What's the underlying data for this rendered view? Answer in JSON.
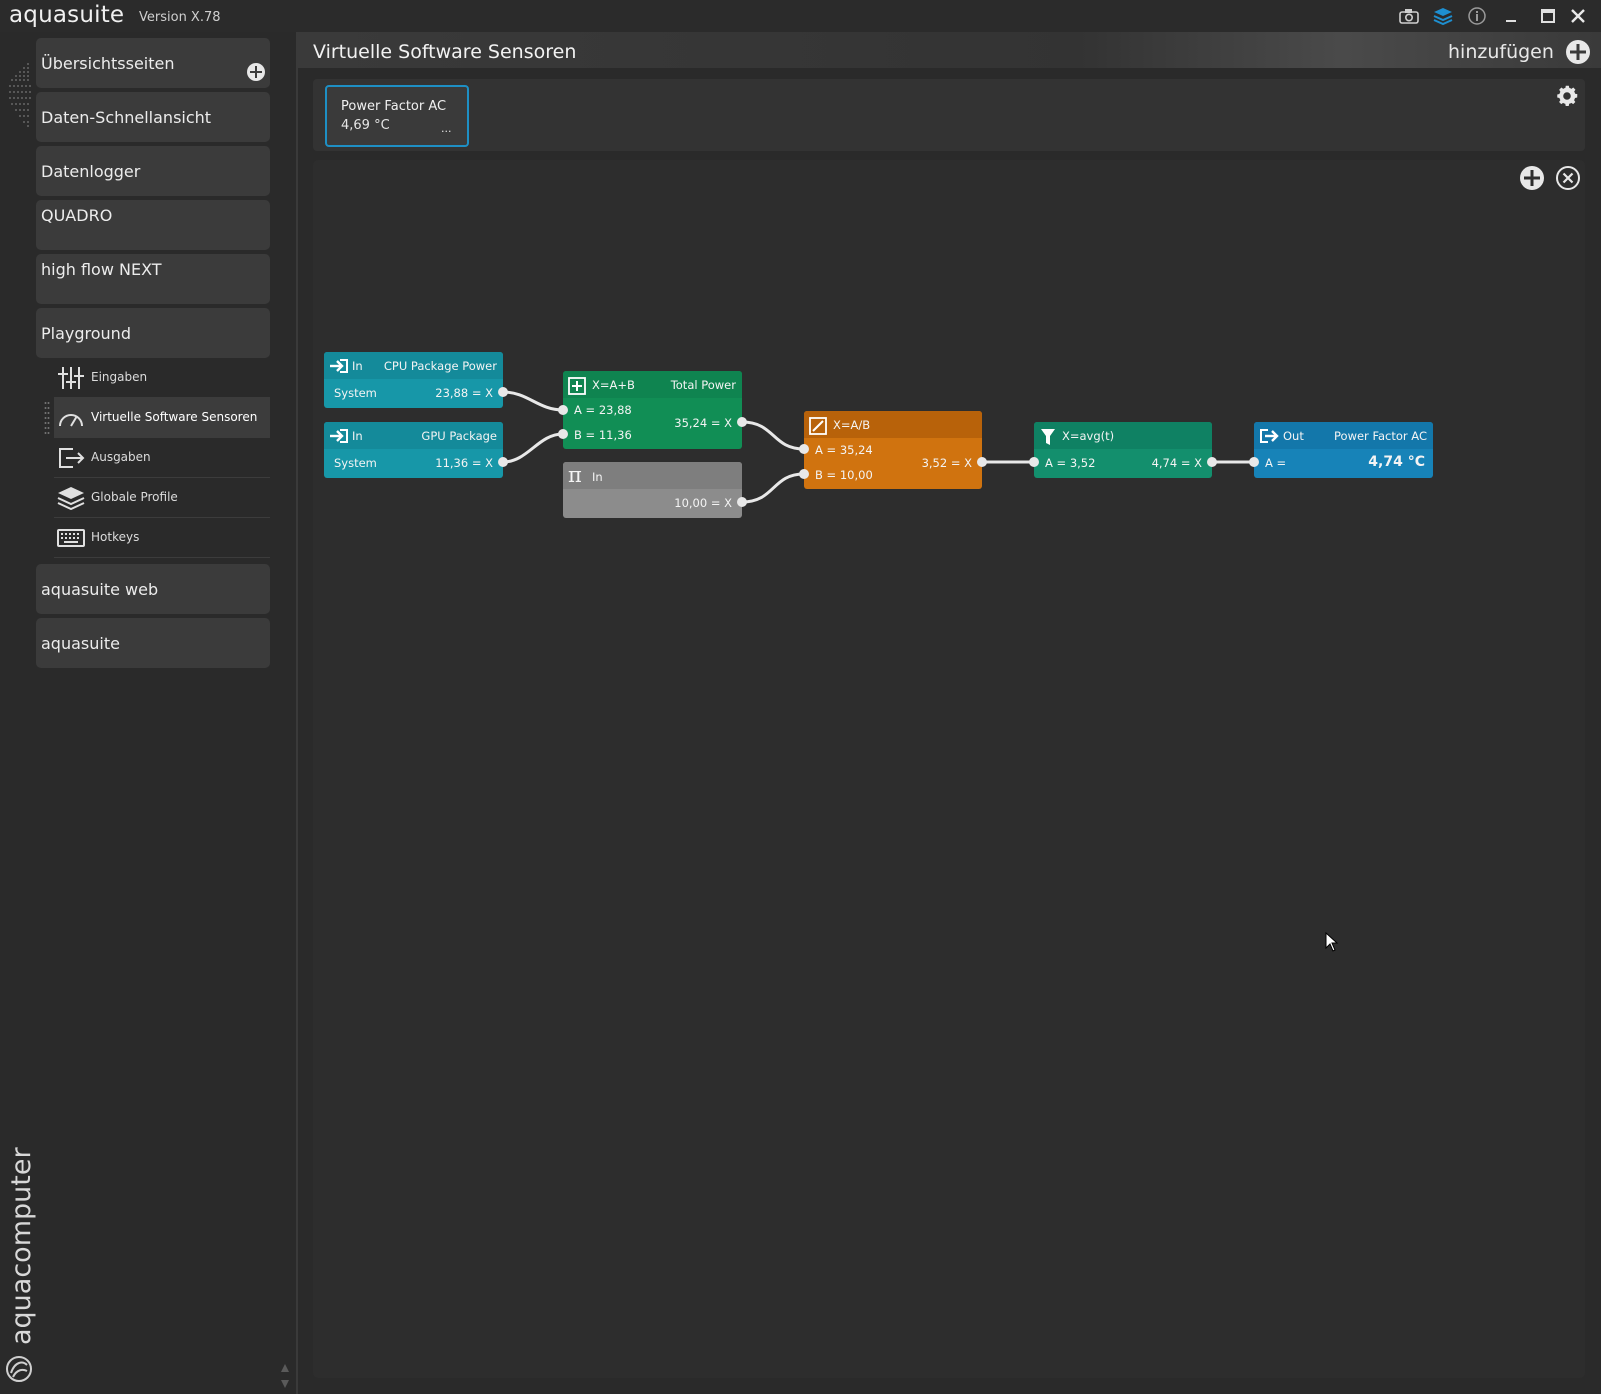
{
  "app": {
    "name": "aquasuite",
    "version": "Version X.78",
    "brand_vertical": "aquacomputer",
    "icons": [
      "camera-icon",
      "layers-icon",
      "info-icon",
      "minimize-icon",
      "maximize-icon",
      "close-icon"
    ]
  },
  "sidebar": {
    "items": [
      {
        "label": "Übersichtsseiten"
      },
      {
        "label": "Daten-Schnellansicht"
      },
      {
        "label": "Datenlogger"
      },
      {
        "label": "QUADRO"
      },
      {
        "label": "high flow NEXT"
      },
      {
        "label": "Playground"
      }
    ],
    "sub_items": [
      {
        "label": "Eingaben",
        "icon": "sliders-icon"
      },
      {
        "label": "Virtuelle Software Sensoren",
        "icon": "gauge-icon",
        "active": true
      },
      {
        "label": "Ausgaben",
        "icon": "output-icon"
      },
      {
        "label": "Globale Profile",
        "icon": "layers-icon"
      },
      {
        "label": "Hotkeys",
        "icon": "keyboard-icon"
      }
    ],
    "bottom_items": [
      {
        "label": "aquasuite web"
      },
      {
        "label": "aquasuite"
      }
    ]
  },
  "header": {
    "title": "Virtuelle Software Sensoren",
    "add_label": "hinzufügen"
  },
  "overview": {
    "tile_name": "Power Factor AC",
    "tile_value": "4,69 °C",
    "tile_more": "..."
  },
  "nodes": {
    "cpu": {
      "type": "In",
      "name": "CPU Package Power",
      "source": "System",
      "output": "23,88 = X"
    },
    "gpu": {
      "type": "In",
      "name": "GPU Package",
      "source": "System",
      "output": "11,36 = X"
    },
    "const": {
      "type": "In",
      "output": "10,00 = X"
    },
    "sum": {
      "formula": "X=A+B",
      "name": "Total Power",
      "a": "A = 23,88",
      "b": "B = 11,36",
      "output": "35,24 = X"
    },
    "div": {
      "formula": "X=A/B",
      "a": "A = 35,24",
      "b": "B = 10,00",
      "output": "3,52 = X"
    },
    "avg": {
      "formula": "X=avg(t)",
      "a": "A = 3,52",
      "output": "4,74 = X"
    },
    "out": {
      "type": "Out",
      "name": "Power Factor AC",
      "a": "A =",
      "value": "4,74 °C"
    }
  },
  "colors": {
    "input_node": "#1797a8",
    "sum_node": "#118e55",
    "const_node": "#8c8c8c",
    "div_node": "#d0730f",
    "avg_node": "#138f6d",
    "out_node": "#1783b8",
    "accent": "#1e8fc4"
  }
}
